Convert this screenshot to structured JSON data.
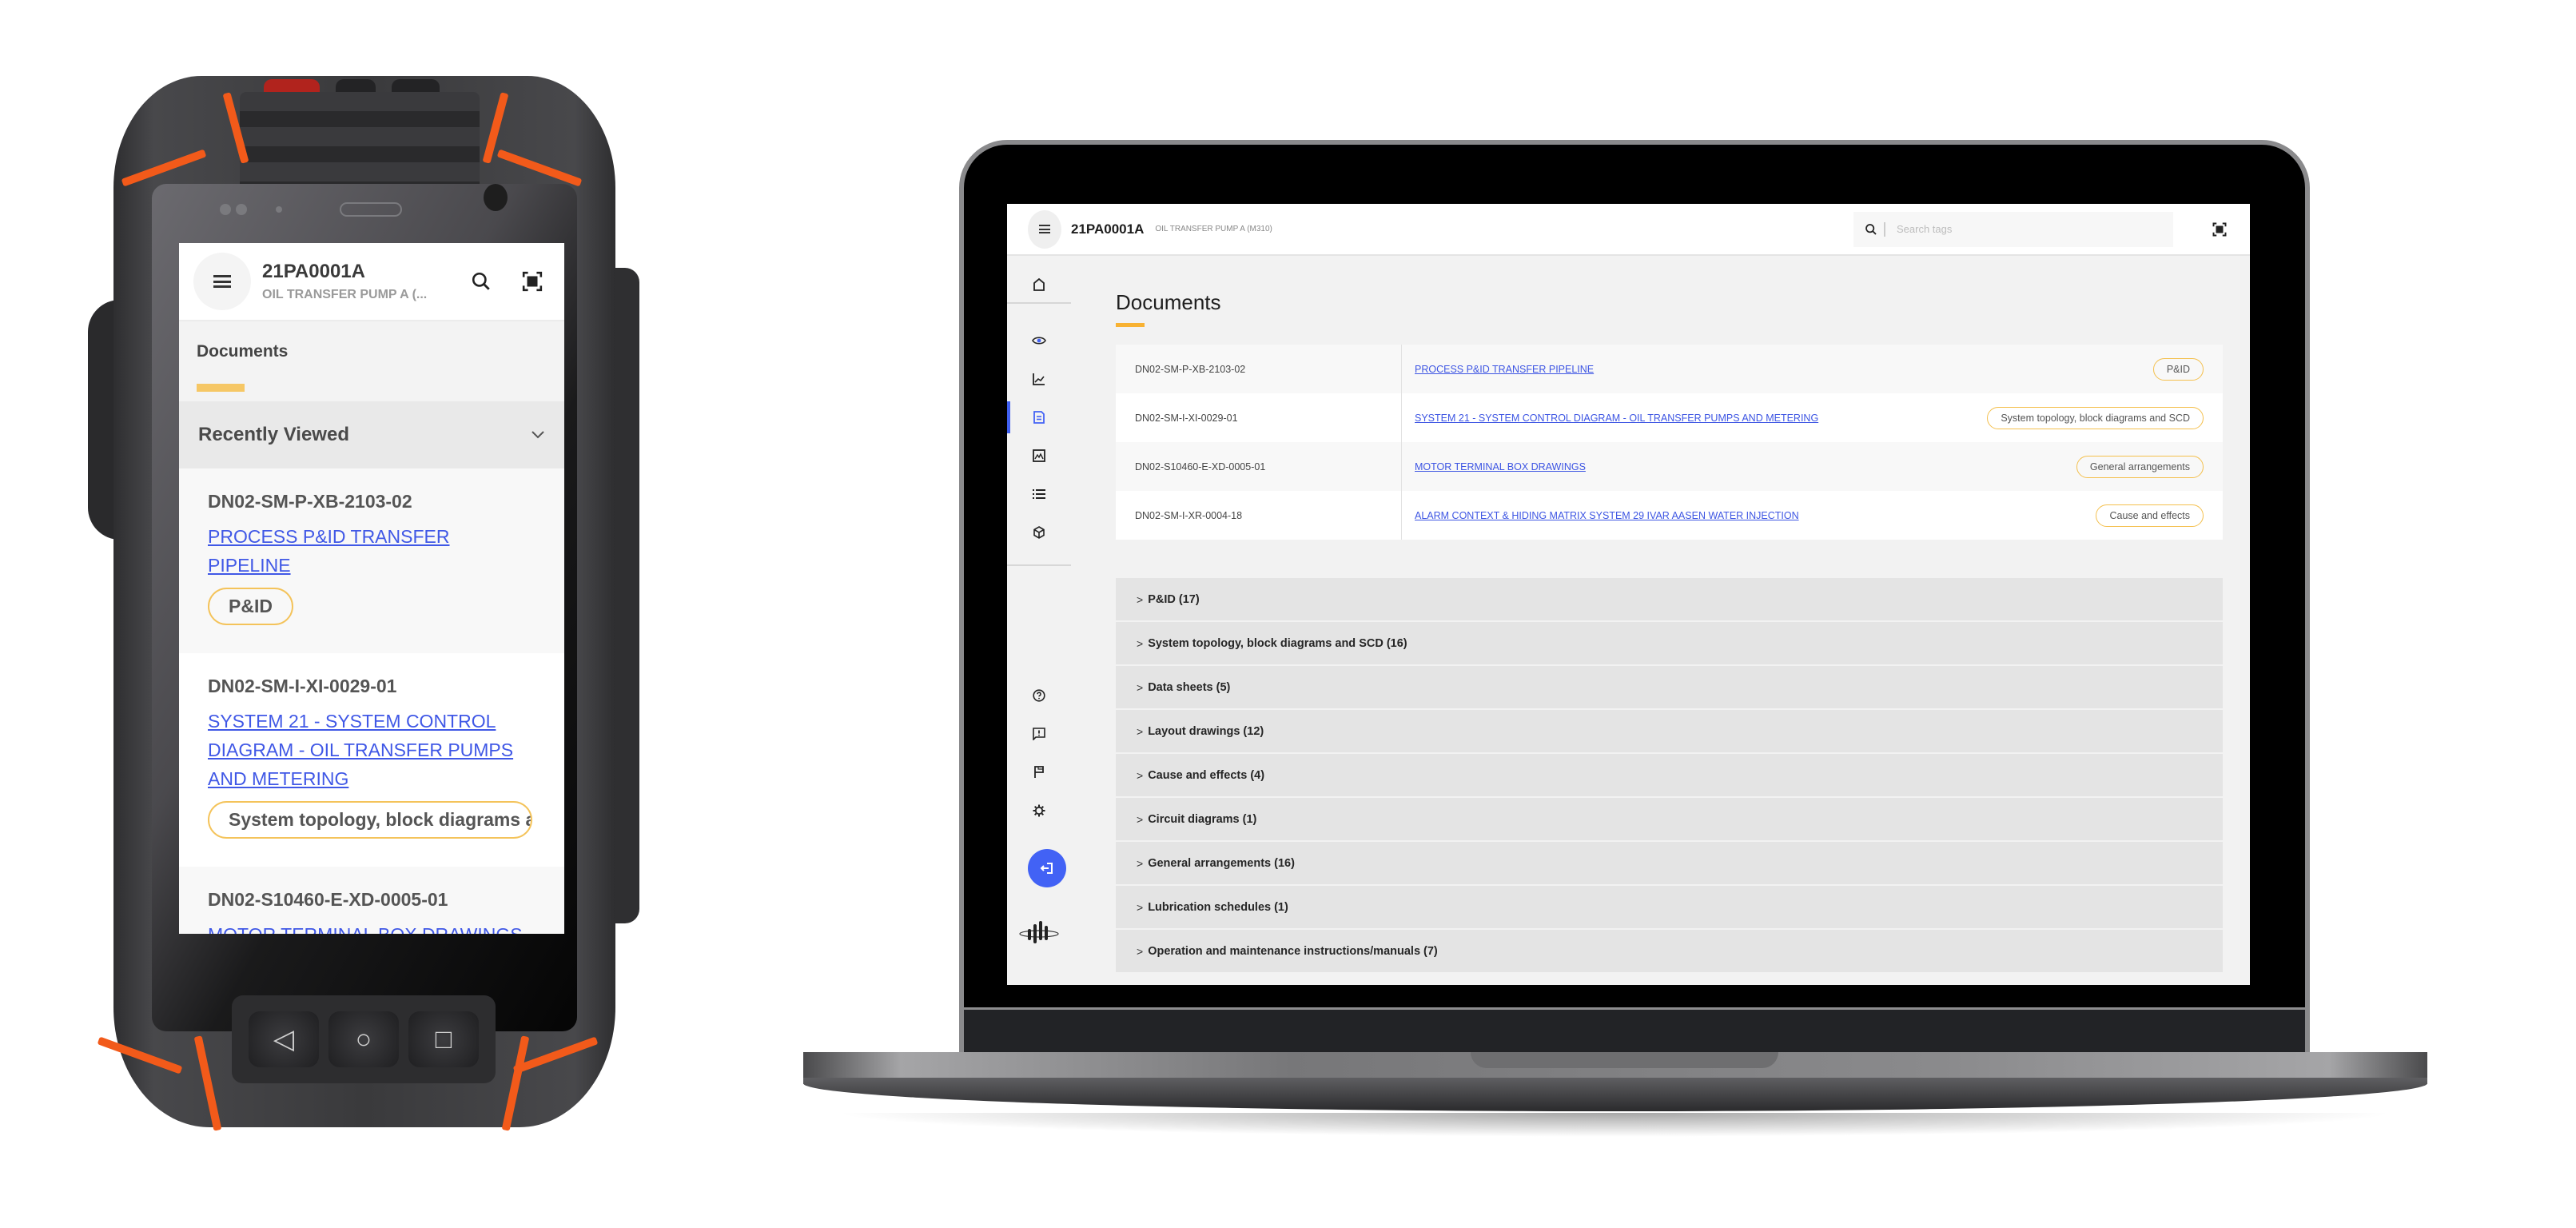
{
  "app": {
    "tag": "21PA0001A",
    "tag_description": "OIL TRANSFER PUMP A (M310)",
    "tag_description_truncated": "OIL TRANSFER PUMP A (...",
    "section_title": "Documents"
  },
  "colors": {
    "accent_blue": "#4262f5",
    "accent_yellow": "#f8b233",
    "badge_border": "#f4c04e",
    "link": "#3d55e3",
    "device_accent_orange": "#f25a1a"
  },
  "search": {
    "placeholder": "Search tags",
    "value": ""
  },
  "icons": {
    "menu": "hamburger-menu-icon",
    "search": "search-icon",
    "scan": "scan-icon"
  },
  "sidebar": {
    "items": [
      {
        "icon": "home-icon",
        "active": false
      },
      {
        "icon": "eye-icon",
        "active": false
      },
      {
        "icon": "chart-icon",
        "active": false
      },
      {
        "icon": "document-icon",
        "active": true
      },
      {
        "icon": "image-icon",
        "active": false
      },
      {
        "icon": "list-icon",
        "active": false
      },
      {
        "icon": "cube-icon",
        "active": false
      }
    ],
    "bottom_items": [
      {
        "icon": "help-icon"
      },
      {
        "icon": "feedback-icon"
      },
      {
        "icon": "flag-icon"
      },
      {
        "icon": "settings-icon"
      }
    ],
    "logout_icon": "logout-icon",
    "logo_icon": "brand-logo-icon"
  },
  "phone": {
    "recently_viewed_label": "Recently Viewed",
    "nav_buttons": [
      "◁",
      "○",
      "□"
    ]
  },
  "recent_documents": [
    {
      "code": "DN02-SM-P-XB-2103-02",
      "title": "PROCESS P&ID TRANSFER PIPELINE",
      "category": "P&ID"
    },
    {
      "code": "DN02-SM-I-XI-0029-01",
      "title": "SYSTEM 21 - SYSTEM CONTROL DIAGRAM - OIL TRANSFER PUMPS AND METERING",
      "category": "System topology, block diagrams and SCD"
    },
    {
      "code": "DN02-S10460-E-XD-0005-01",
      "title": "MOTOR TERMINAL BOX DRAWINGS",
      "category": "General arrangements"
    },
    {
      "code": "DN02-SM-I-XR-0004-18",
      "title": "ALARM CONTEXT & HIDING MATRIX SYSTEM 29 IVAR AASEN WATER INJECTION",
      "category": "Cause and effects"
    }
  ],
  "document_groups": [
    {
      "label": "P&ID (17)"
    },
    {
      "label": "System topology, block diagrams and SCD (16)"
    },
    {
      "label": "Data sheets (5)"
    },
    {
      "label": "Layout drawings (12)"
    },
    {
      "label": "Cause and effects (4)"
    },
    {
      "label": "Circuit diagrams (1)"
    },
    {
      "label": "General arrangements (16)"
    },
    {
      "label": "Lubrication schedules (1)"
    },
    {
      "label": "Operation and maintenance instructions/manuals (7)"
    }
  ],
  "chevron_right": ">",
  "chevron_down": "⌄"
}
